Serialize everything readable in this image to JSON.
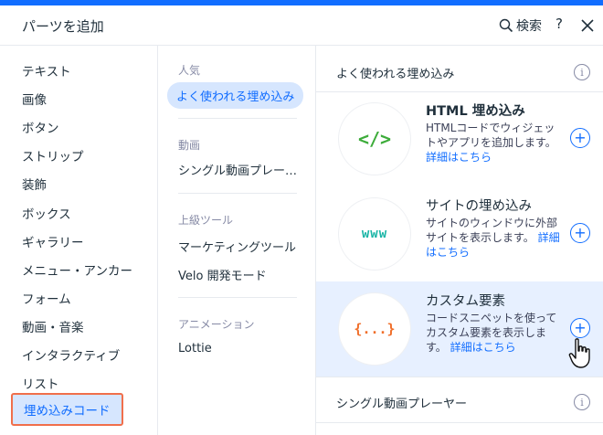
{
  "header": {
    "title": "パーツを追加",
    "search_label": "検索",
    "help_label": "?"
  },
  "categories": [
    {
      "label": "テキスト"
    },
    {
      "label": "画像"
    },
    {
      "label": "ボタン"
    },
    {
      "label": "ストリップ"
    },
    {
      "label": "装飾"
    },
    {
      "label": "ボックス"
    },
    {
      "label": "ギャラリー"
    },
    {
      "label": "メニュー・アンカー"
    },
    {
      "label": "フォーム"
    },
    {
      "label": "動画・音楽"
    },
    {
      "label": "インタラクティブ"
    },
    {
      "label": "リスト"
    },
    {
      "label": "埋め込みコード",
      "selected": true
    }
  ],
  "subcategories": {
    "popular_heading": "人気",
    "popular_item": "よく使われる埋め込み",
    "video_heading": "動画",
    "video_item": "シングル動画プレーヤー",
    "advanced_heading": "上級ツール",
    "advanced_item1": "マーケティングツール",
    "advanced_item2": "Velo 開発モード",
    "animation_heading": "アニメーション",
    "animation_item": "Lottie"
  },
  "section1": {
    "title": "よく使われる埋め込み",
    "info": "i"
  },
  "cards": [
    {
      "icon_text": "</>",
      "icon_color": "#3dac3a",
      "title": "HTML 埋め込み",
      "desc": "HTMLコードでウィジェットやアプリを追加します。",
      "link": "詳細はこちら",
      "add": "+"
    },
    {
      "icon_text": "www",
      "icon_color": "#1ab5a6",
      "title": "サイトの埋め込み",
      "desc": "サイトのウィンドウに外部サイトを表示します。",
      "link": "詳細はこちら",
      "add": "+"
    },
    {
      "icon_text": "{...}",
      "icon_color": "#f06f2b",
      "title": "カスタム要素",
      "desc": "コードスニペットを使ってカスタム要素を表示します。",
      "link": "詳細はこちら",
      "add": "+"
    }
  ],
  "section2": {
    "title": "シングル動画プレーヤー",
    "info": "i"
  },
  "colors": {
    "accent": "#116dff",
    "highlight": "#f06f4b"
  }
}
